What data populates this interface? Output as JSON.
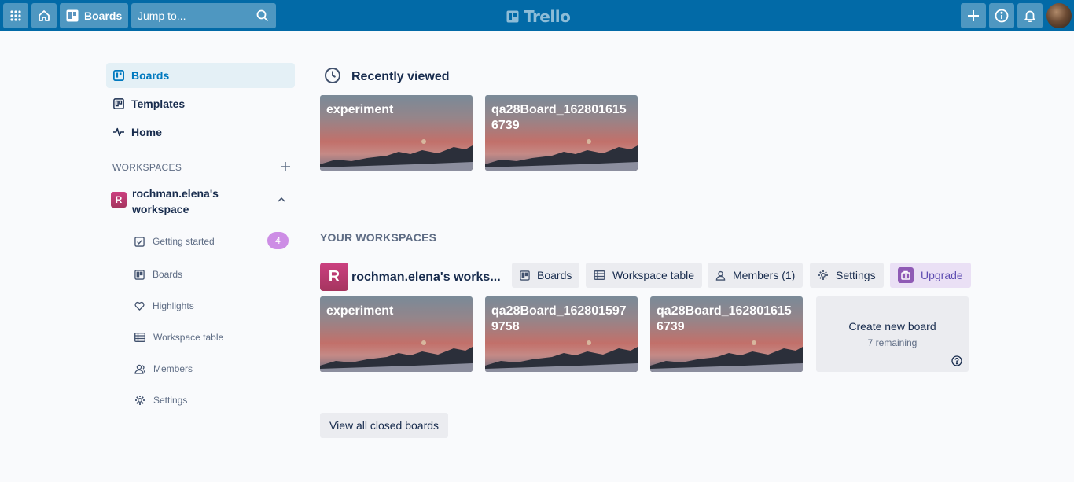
{
  "header": {
    "boards_label": "Boards",
    "search_placeholder": "Jump to...",
    "logo_text": "Trello",
    "icons": [
      "apps-grid-icon",
      "home-icon",
      "board-icon",
      "search-icon",
      "plus-icon",
      "info-icon",
      "bell-icon"
    ]
  },
  "sidebar": {
    "nav": [
      {
        "label": "Boards",
        "icon": "board-icon",
        "active": true
      },
      {
        "label": "Templates",
        "icon": "template-icon"
      },
      {
        "label": "Home",
        "icon": "activity-icon"
      }
    ],
    "workspaces_label": "WORKSPACES",
    "workspace": {
      "initial": "R",
      "name": "rochman.elena's workspace"
    },
    "sub_items": [
      {
        "label": "Getting started",
        "icon": "checkbox-icon",
        "count": "4"
      },
      {
        "label": "Boards",
        "icon": "board-icon"
      },
      {
        "label": "Highlights",
        "icon": "heart-icon"
      },
      {
        "label": "Workspace table",
        "icon": "table-icon"
      },
      {
        "label": "Members",
        "icon": "members-icon"
      },
      {
        "label": "Settings",
        "icon": "gear-icon"
      }
    ]
  },
  "recent": {
    "title": "Recently viewed",
    "boards": [
      "experiment",
      "qa28Board_1628016156739"
    ]
  },
  "your_workspaces": {
    "title": "YOUR WORKSPACES",
    "workspace_initial": "R",
    "workspace_name": "rochman.elena's works...",
    "buttons": {
      "boards": "Boards",
      "table": "Workspace table",
      "members": "Members (1)",
      "settings": "Settings",
      "upgrade": "Upgrade"
    },
    "boards": [
      "experiment",
      "qa28Board_1628015979758",
      "qa28Board_1628016156739"
    ],
    "create": {
      "title": "Create new board",
      "remaining": "7 remaining"
    },
    "view_closed": "View all closed boards"
  },
  "colors": {
    "header": "#026aa7",
    "accent": "#0079bf",
    "workspace_badge": "#b83a6e",
    "upgrade": "#8f5ab5"
  }
}
